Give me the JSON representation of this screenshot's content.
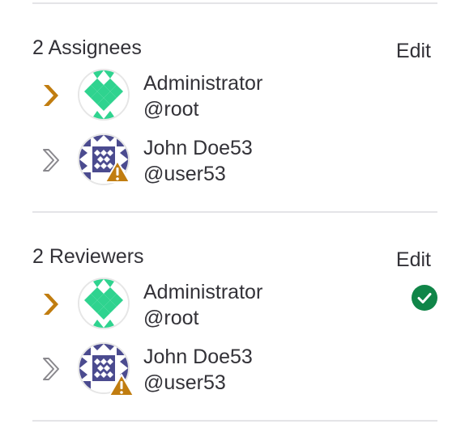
{
  "assignees": {
    "title": "2 Assignees",
    "edit_label": "Edit",
    "users": [
      {
        "name": "Administrator",
        "handle": "@root",
        "attention": true,
        "avatar_icon": "green-identicon"
      },
      {
        "name": "John Doe53",
        "handle": "@user53",
        "attention": false,
        "avatar_icon": "navy-identicon",
        "warning_icon": "warning-icon"
      }
    ]
  },
  "reviewers": {
    "title": "2 Reviewers",
    "edit_label": "Edit",
    "users": [
      {
        "name": "Administrator",
        "handle": "@root",
        "attention": true,
        "avatar_icon": "green-identicon",
        "status_icon": "check-circle-icon"
      },
      {
        "name": "John Doe53",
        "handle": "@user53",
        "attention": false,
        "avatar_icon": "navy-identicon",
        "warning_icon": "warning-icon"
      }
    ]
  },
  "colors": {
    "attention": "#c17d10",
    "neutral_chevron": "#89888d",
    "green_identicon": "#2fd38f",
    "navy_identicon": "#4b4b8f",
    "warning": "#c17d10",
    "approved": "#108548",
    "divider": "#e4e4e7"
  }
}
